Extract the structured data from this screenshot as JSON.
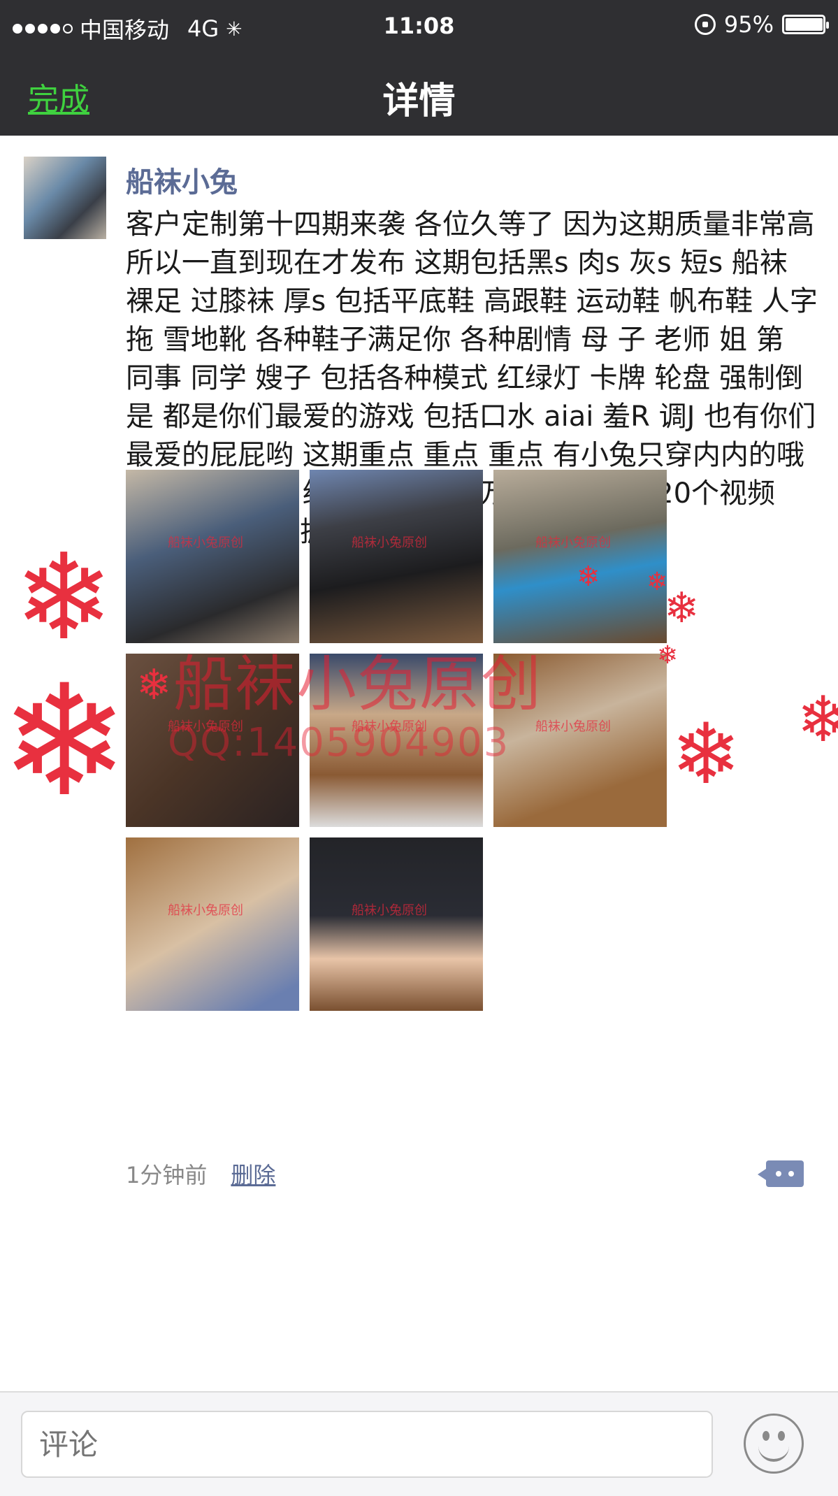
{
  "status_bar": {
    "carrier": "中国移动",
    "network": "4G",
    "time": "11:08",
    "battery": "95%"
  },
  "nav": {
    "done_label": "完成",
    "title": "详情"
  },
  "post": {
    "author": "船袜小兔",
    "text": "客户定制第十四期来袭 各位久等了 因为这期质量非常高 所以一直到现在才发布 这期包括黑s 肉s 灰s 短s 船袜 裸足 过膝袜 厚s 包括平底鞋 高跟鞋 运动鞋 帆布鞋 人字拖 雪地靴 各种鞋子满足你 各种剧情 母 子 老师 姐 第 同事 同学 嫂子 包括各种模式 红绿灯 卡牌 轮盘 强制倒是 都是你们最爱的游戏 包括口水 aiai 羞R 调J 也有你们最爱的屁屁哟 这期重点 重点 重点 有小兔只穿内内的哦 全程只穿内内 绝对的劲爆 千万别错过 一共20个视频 150带走 需要抓紧咯",
    "watermark_big": "船袜小兔原创",
    "watermark_qq": "QQ:1405904903",
    "thumb_watermark": "船袜小兔原创",
    "time_ago": "1分钟前",
    "delete_label": "删除"
  },
  "comment": {
    "placeholder": "评论"
  }
}
